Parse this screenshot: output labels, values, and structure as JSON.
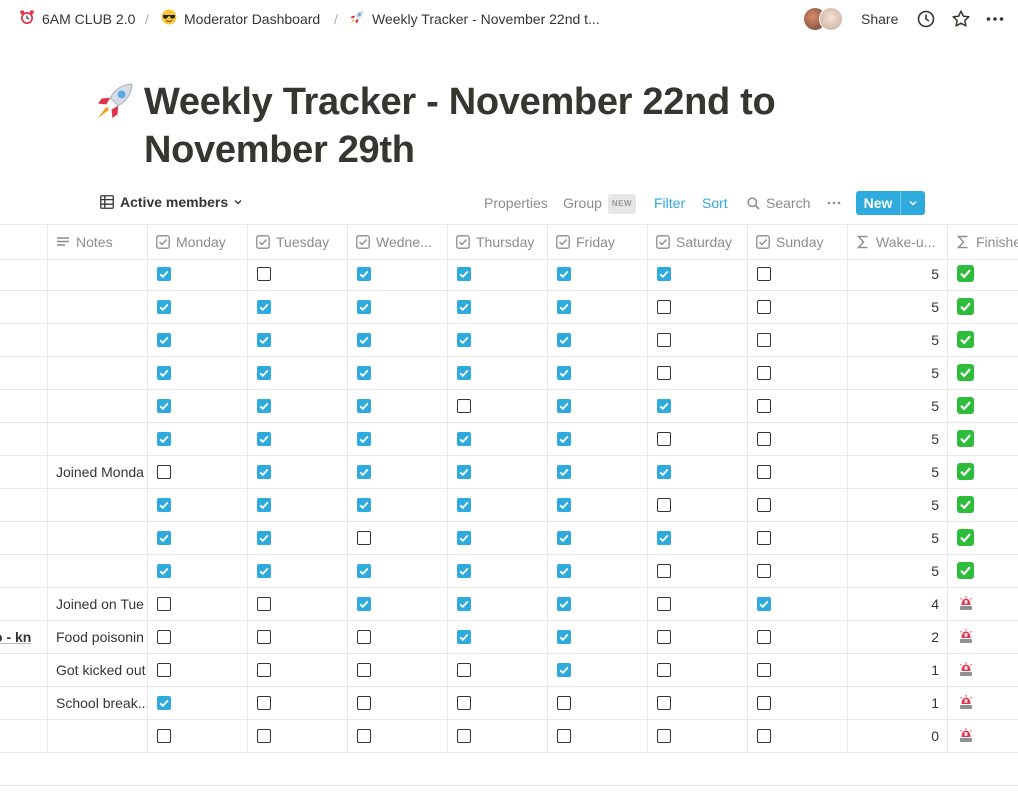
{
  "breadcrumb": [
    {
      "icon": "alarm-clock-emoji",
      "label": "6AM CLUB 2.0"
    },
    {
      "icon": "sunglasses-face-emoji",
      "label": "Moderator Dashboard"
    },
    {
      "icon": "rocket-emoji",
      "label": "Weekly Tracker - November 22nd t..."
    }
  ],
  "topbar": {
    "share_label": "Share",
    "separator": "/"
  },
  "page": {
    "title": "Weekly Tracker - November 22nd to November 29th",
    "icon": "rocket-emoji"
  },
  "view": {
    "name": "Active members",
    "properties_label": "Properties",
    "group_label": "Group",
    "group_badge": "NEW",
    "filter_label": "Filter",
    "sort_label": "Sort",
    "search_label": "Search",
    "new_label": "New"
  },
  "colors": {
    "accent": "#2eaadc",
    "done_green": "#2dbd3b",
    "siren_red": "#e0364c"
  },
  "table": {
    "columns": [
      "Notes",
      "Monday",
      "Tuesday",
      "Wedne...",
      "Thursday",
      "Friday",
      "Saturday",
      "Sunday",
      "Wake-u...",
      "Finishe"
    ],
    "column_icons": [
      "text-lines-icon",
      "checkbox-icon",
      "checkbox-icon",
      "checkbox-icon",
      "checkbox-icon",
      "checkbox-icon",
      "checkbox-icon",
      "checkbox-icon",
      "sigma-icon",
      "sigma-icon"
    ],
    "rows": [
      {
        "name_fragment": "",
        "notes": "",
        "days": [
          true,
          false,
          true,
          true,
          true,
          true,
          false
        ],
        "wakeups": "5",
        "finished": "check-mark-button-emoji"
      },
      {
        "name_fragment": "",
        "notes": "",
        "days": [
          true,
          true,
          true,
          true,
          true,
          false,
          false
        ],
        "wakeups": "5",
        "finished": "check-mark-button-emoji"
      },
      {
        "name_fragment": "",
        "notes": "",
        "days": [
          true,
          true,
          true,
          true,
          true,
          false,
          false
        ],
        "wakeups": "5",
        "finished": "check-mark-button-emoji"
      },
      {
        "name_fragment": "",
        "notes": "",
        "days": [
          true,
          true,
          true,
          true,
          true,
          false,
          false
        ],
        "wakeups": "5",
        "finished": "check-mark-button-emoji"
      },
      {
        "name_fragment": "",
        "notes": "",
        "days": [
          true,
          true,
          true,
          false,
          true,
          true,
          false
        ],
        "wakeups": "5",
        "finished": "check-mark-button-emoji"
      },
      {
        "name_fragment": "",
        "notes": "",
        "days": [
          true,
          true,
          true,
          true,
          true,
          false,
          false
        ],
        "wakeups": "5",
        "finished": "check-mark-button-emoji"
      },
      {
        "name_fragment": "",
        "notes": "Joined Monda",
        "days": [
          false,
          true,
          true,
          true,
          true,
          true,
          false
        ],
        "wakeups": "5",
        "finished": "check-mark-button-emoji"
      },
      {
        "name_fragment": "",
        "notes": "",
        "days": [
          true,
          true,
          true,
          true,
          true,
          false,
          false
        ],
        "wakeups": "5",
        "finished": "check-mark-button-emoji"
      },
      {
        "name_fragment": "",
        "notes": "",
        "days": [
          true,
          true,
          false,
          true,
          true,
          true,
          false
        ],
        "wakeups": "5",
        "finished": "check-mark-button-emoji"
      },
      {
        "name_fragment": "",
        "notes": "",
        "days": [
          true,
          true,
          true,
          true,
          true,
          false,
          false
        ],
        "wakeups": "5",
        "finished": "check-mark-button-emoji"
      },
      {
        "name_fragment": "",
        "notes": "Joined on Tue",
        "days": [
          false,
          false,
          true,
          true,
          true,
          false,
          true
        ],
        "wakeups": "4",
        "finished": "police-light-emoji"
      },
      {
        "name_fragment": "o - kn",
        "notes": "Food poisonin",
        "days": [
          false,
          false,
          false,
          true,
          true,
          false,
          false
        ],
        "wakeups": "2",
        "finished": "police-light-emoji"
      },
      {
        "name_fragment": "",
        "notes": "Got kicked out",
        "days": [
          false,
          false,
          false,
          false,
          true,
          false,
          false
        ],
        "wakeups": "1",
        "finished": "police-light-emoji"
      },
      {
        "name_fragment": "",
        "notes": "School break...",
        "days": [
          true,
          false,
          false,
          false,
          false,
          false,
          false
        ],
        "wakeups": "1",
        "finished": "police-light-emoji"
      },
      {
        "name_fragment": "",
        "notes": "",
        "days": [
          false,
          false,
          false,
          false,
          false,
          false,
          false
        ],
        "wakeups": "0",
        "finished": "police-light-emoji"
      }
    ]
  }
}
